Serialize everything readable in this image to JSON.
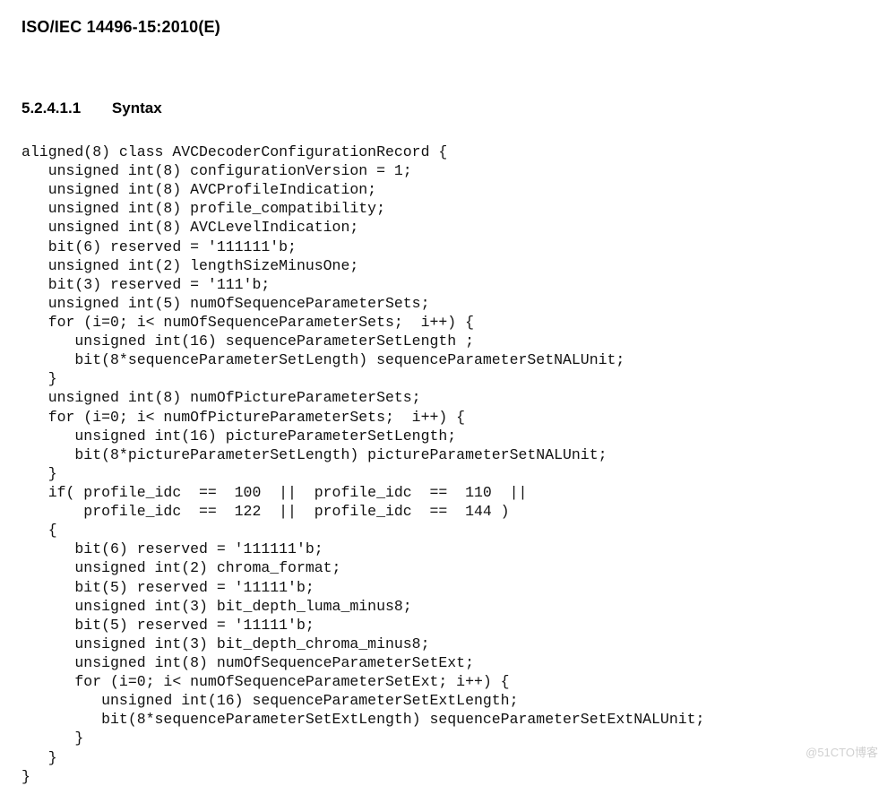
{
  "header": {
    "standard": "ISO/IEC 14496-15:2010(E)"
  },
  "section": {
    "number": "5.2.4.1.1",
    "title": "Syntax"
  },
  "code": "aligned(8) class AVCDecoderConfigurationRecord {\n   unsigned int(8) configurationVersion = 1;\n   unsigned int(8) AVCProfileIndication;\n   unsigned int(8) profile_compatibility;\n   unsigned int(8) AVCLevelIndication;\n   bit(6) reserved = '111111'b;\n   unsigned int(2) lengthSizeMinusOne;\n   bit(3) reserved = '111'b;\n   unsigned int(5) numOfSequenceParameterSets;\n   for (i=0; i< numOfSequenceParameterSets;  i++) {\n      unsigned int(16) sequenceParameterSetLength ;\n      bit(8*sequenceParameterSetLength) sequenceParameterSetNALUnit;\n   }\n   unsigned int(8) numOfPictureParameterSets;\n   for (i=0; i< numOfPictureParameterSets;  i++) {\n      unsigned int(16) pictureParameterSetLength;\n      bit(8*pictureParameterSetLength) pictureParameterSetNALUnit;\n   }\n   if( profile_idc  ==  100  ||  profile_idc  ==  110  ||\n       profile_idc  ==  122  ||  profile_idc  ==  144 )\n   {\n      bit(6) reserved = '111111'b;\n      unsigned int(2) chroma_format;\n      bit(5) reserved = '11111'b;\n      unsigned int(3) bit_depth_luma_minus8;\n      bit(5) reserved = '11111'b;\n      unsigned int(3) bit_depth_chroma_minus8;\n      unsigned int(8) numOfSequenceParameterSetExt;\n      for (i=0; i< numOfSequenceParameterSetExt; i++) {\n         unsigned int(16) sequenceParameterSetExtLength;\n         bit(8*sequenceParameterSetExtLength) sequenceParameterSetExtNALUnit;\n      }\n   }\n}",
  "watermark": "@51CTO博客"
}
